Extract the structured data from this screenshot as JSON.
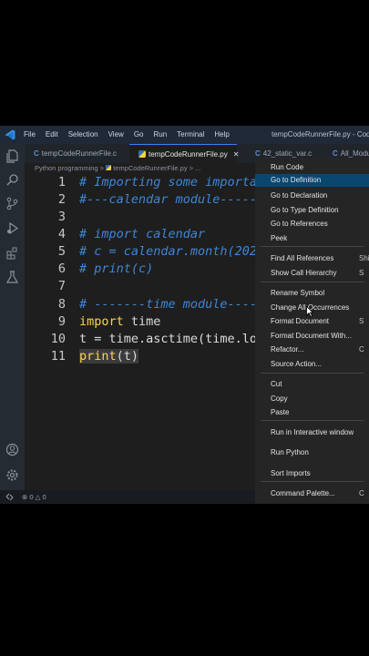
{
  "window": {
    "title": "tempCodeRunnerFile.py - Coding",
    "menus": [
      "File",
      "Edit",
      "Selection",
      "View",
      "Go",
      "Run",
      "Terminal",
      "Help"
    ]
  },
  "tabs": [
    {
      "label": "tempCodeRunnerFile.c",
      "icon": "c-file-icon"
    },
    {
      "label": "tempCodeRunnerFile.py",
      "icon": "python-file-icon",
      "active": true,
      "close": "✕"
    },
    {
      "label": "42_static_var.c",
      "icon": "c-file-icon"
    },
    {
      "label": "All_Module",
      "icon": "c-file-icon"
    }
  ],
  "breadcrumb": {
    "folder": "Python programming",
    "sep": ">",
    "file": "tempCodeRunnerFile.py",
    "more": "> ..."
  },
  "editor": {
    "lines": [
      {
        "n": "1",
        "text": "# Importing some importa"
      },
      {
        "n": "2",
        "text": "#---calendar module-----"
      },
      {
        "n": "3",
        "text": ""
      },
      {
        "n": "4",
        "text": "# import calendar"
      },
      {
        "n": "5",
        "text": "# c = calendar.month(202"
      },
      {
        "n": "6",
        "text": "# print(c)"
      },
      {
        "n": "7",
        "text": ""
      },
      {
        "n": "8",
        "text": "# -------time module----"
      },
      {
        "n": "9",
        "kw": "import",
        "rest": " time"
      },
      {
        "n": "10",
        "pre": "t = time.asctime(time.lo",
        "text": "t = time.asctime(time.lo"
      },
      {
        "n": "11",
        "kw": "print",
        "rest": "(t)"
      }
    ]
  },
  "status": {
    "errors": "0",
    "warnings": "0"
  },
  "context_menu": {
    "items": [
      {
        "label": "Run Code",
        "y": 0
      },
      {
        "label": "Go to Definition",
        "highlight": true
      },
      {
        "label": "Go to Declaration"
      },
      {
        "label": "Go to Type Definition"
      },
      {
        "label": "Go to References"
      },
      {
        "label": "Peek"
      },
      {
        "label": "Find All References",
        "shortcut": "Shi"
      },
      {
        "label": "Show Call Hierarchy",
        "shortcut": "S"
      },
      {
        "label": "Rename Symbol"
      },
      {
        "label": "Change All Occurrences"
      },
      {
        "label": "Format Document",
        "shortcut": "S"
      },
      {
        "label": "Format Document With..."
      },
      {
        "label": "Refactor...",
        "shortcut": "C"
      },
      {
        "label": "Source Action..."
      },
      {
        "label": "Cut"
      },
      {
        "label": "Copy"
      },
      {
        "label": "Paste"
      },
      {
        "label": "Run in Interactive window"
      },
      {
        "label": "Run Python"
      },
      {
        "label": "Sort Imports"
      },
      {
        "label": "Command Palette...",
        "shortcut": "C"
      }
    ]
  },
  "colors": {
    "accent": "#3b82f6",
    "comment": "#3e86d6",
    "keyword": "#ffd54a",
    "menu_highlight": "#094771"
  }
}
